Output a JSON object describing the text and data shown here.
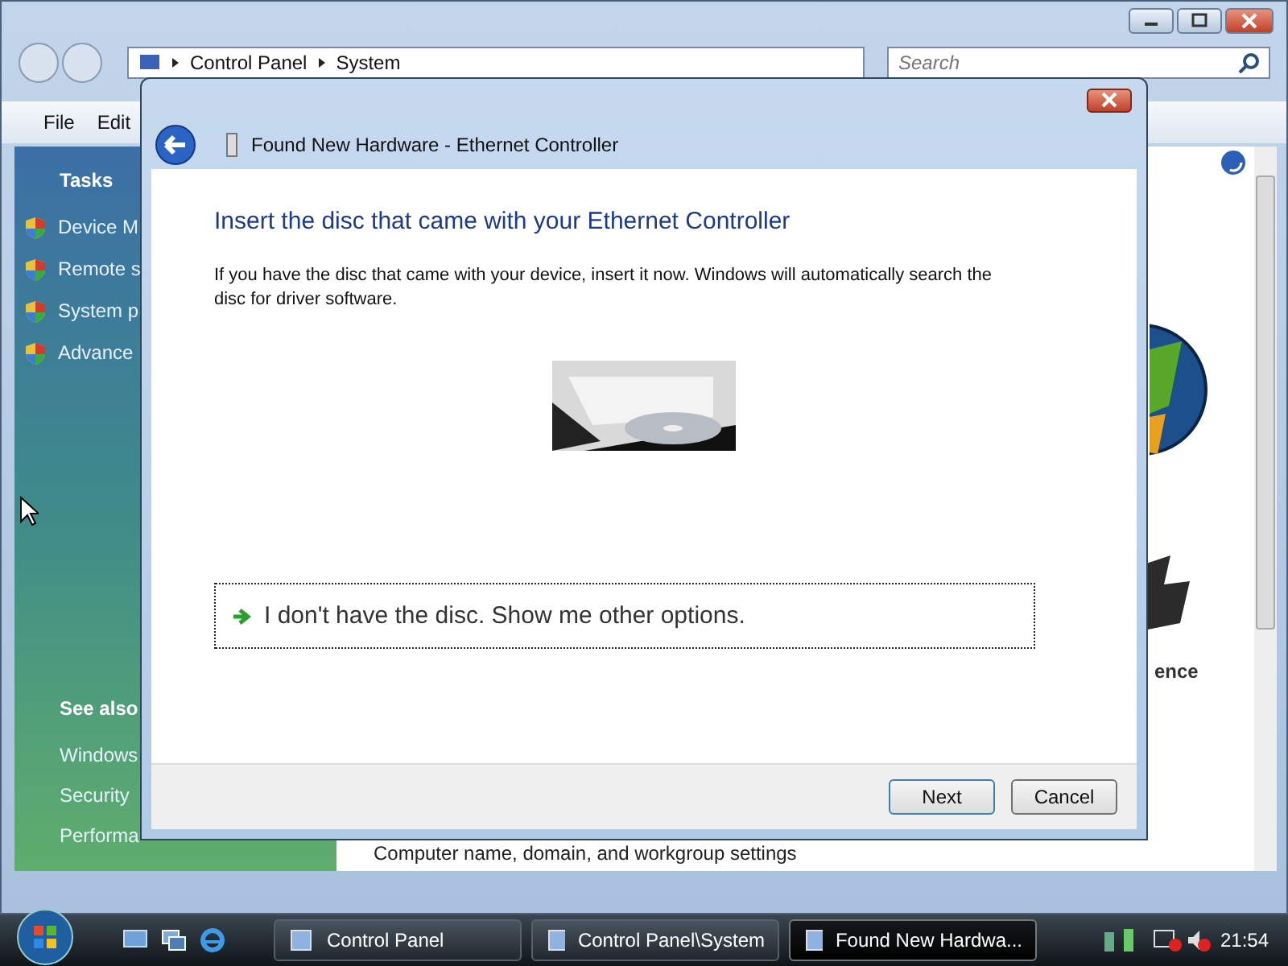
{
  "window": {
    "address": [
      "Control Panel",
      "System"
    ],
    "search": {
      "placeholder": "Search"
    },
    "menu": [
      "File",
      "Edit"
    ],
    "sidebar": {
      "tasks_title": "Tasks",
      "tasks": [
        "Device M",
        "Remote s",
        "System p",
        "Advance"
      ],
      "see_also_title": "See also",
      "see_also": [
        "Windows",
        "Security",
        "Performa"
      ]
    },
    "content": {
      "caption": "ence",
      "footer_link": "Computer name, domain, and workgroup settings"
    }
  },
  "dialog": {
    "title": "Found New Hardware - Ethernet Controller",
    "heading": "Insert the disc that came with your Ethernet Controller",
    "body": "If you have the disc that came with your device, insert it now.  Windows will automatically search the disc for driver software.",
    "option": {
      "label": "I don't have the disc.  Show me other options.",
      "focused": true
    },
    "buttons": [
      {
        "label": "Next",
        "kind": "default"
      },
      {
        "label": "Cancel",
        "kind": "normal"
      }
    ]
  },
  "taskbar": {
    "tasks": [
      {
        "label": "Control Panel",
        "selected": false
      },
      {
        "label": "Control Panel\\System",
        "selected": false
      },
      {
        "label": "Found New Hardwa...",
        "selected": true
      }
    ],
    "clock": "21:54"
  }
}
